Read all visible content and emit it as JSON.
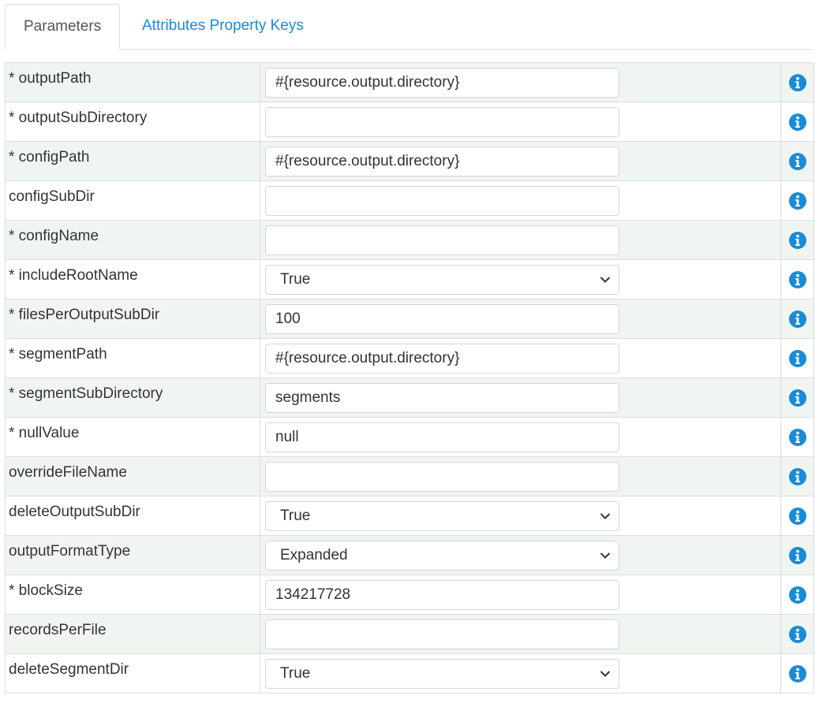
{
  "tabs": [
    {
      "label": "Parameters",
      "active": true
    },
    {
      "label": "Attributes Property Keys",
      "active": false
    }
  ],
  "accent_color": "#1a8bd6",
  "icons": {
    "info": "info-circle-icon",
    "dropdown": "chevron-down-icon"
  },
  "parameters": [
    {
      "label": "* outputPath",
      "type": "text",
      "value": "#{resource.output.directory}"
    },
    {
      "label": "* outputSubDirectory",
      "type": "text",
      "value": ""
    },
    {
      "label": "* configPath",
      "type": "text",
      "value": "#{resource.output.directory}"
    },
    {
      "label": "configSubDir",
      "type": "text",
      "value": ""
    },
    {
      "label": "* configName",
      "type": "text",
      "value": ""
    },
    {
      "label": "* includeRootName",
      "type": "select",
      "value": "True"
    },
    {
      "label": "* filesPerOutputSubDir",
      "type": "text",
      "value": "100"
    },
    {
      "label": "* segmentPath",
      "type": "text",
      "value": "#{resource.output.directory}"
    },
    {
      "label": "* segmentSubDirectory",
      "type": "text",
      "value": "segments"
    },
    {
      "label": "* nullValue",
      "type": "text",
      "value": "null"
    },
    {
      "label": "overrideFileName",
      "type": "text",
      "value": ""
    },
    {
      "label": "deleteOutputSubDir",
      "type": "select",
      "value": "True"
    },
    {
      "label": "outputFormatType",
      "type": "select",
      "value": "Expanded"
    },
    {
      "label": "* blockSize",
      "type": "text",
      "value": "134217728"
    },
    {
      "label": "recordsPerFile",
      "type": "text",
      "value": ""
    },
    {
      "label": "deleteSegmentDir",
      "type": "select",
      "value": "True"
    }
  ]
}
